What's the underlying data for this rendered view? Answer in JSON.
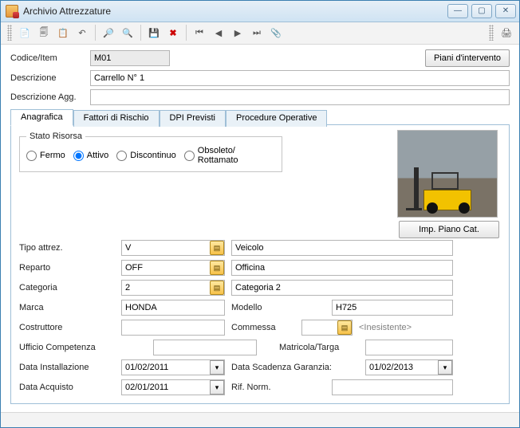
{
  "window": {
    "title": "Archivio Attrezzature"
  },
  "toolbar": {
    "icons": [
      "new",
      "copy",
      "paste",
      "undo",
      "find",
      "find-all",
      "save",
      "delete",
      "nav-first",
      "nav-prev",
      "nav-next",
      "nav-last",
      "attach"
    ],
    "right_icons": [
      "print"
    ]
  },
  "header": {
    "codice_label": "Codice/Item",
    "codice_value": "M01",
    "descrizione_label": "Descrizione",
    "descrizione_value": "Carrello N° 1",
    "descrizione_agg_label": "Descrizione Agg.",
    "descrizione_agg_value": "",
    "piani_btn": "Piani d'intervento"
  },
  "tabs": {
    "items": [
      {
        "label": "Anagrafica"
      },
      {
        "label": "Fattori di Rischio"
      },
      {
        "label": "DPI Previsti"
      },
      {
        "label": "Procedure Operative"
      }
    ]
  },
  "anagrafica": {
    "stato_legend": "Stato Risorsa",
    "stato_options": {
      "fermo": "Fermo",
      "attivo": "Attivo",
      "discontinuo": "Discontinuo",
      "obsoleto": "Obsoleto/\nRottamato"
    },
    "stato_selected": "attivo",
    "img_name": "forklift-photo",
    "imp_piano_btn": "Imp. Piano Cat.",
    "fields": {
      "tipo_attrez_label": "Tipo attrez.",
      "tipo_attrez_code": "V",
      "tipo_attrez_desc": "Veicolo",
      "reparto_label": "Reparto",
      "reparto_code": "OFF",
      "reparto_desc": "Officina",
      "categoria_label": "Categoria",
      "categoria_code": "2",
      "categoria_desc": "Categoria 2",
      "marca_label": "Marca",
      "marca_value": "HONDA",
      "modello_label": "Modello",
      "modello_value": "H725",
      "costruttore_label": "Costruttore",
      "costruttore_value": "",
      "commessa_label": "Commessa",
      "commessa_code": "",
      "commessa_desc": "<Inesistente>",
      "ufficio_label": "Ufficio Competenza",
      "ufficio_value": "",
      "matricola_label": "Matricola/Targa",
      "matricola_value": "",
      "data_install_label": "Data Installazione",
      "data_install_value": "01/02/2011",
      "data_scad_label": "Data Scadenza Garanzia:",
      "data_scad_value": "01/02/2013",
      "data_acq_label": "Data Acquisto",
      "data_acq_value": "02/01/2011",
      "rif_norm_label": "Rif. Norm.",
      "rif_norm_value": ""
    }
  }
}
